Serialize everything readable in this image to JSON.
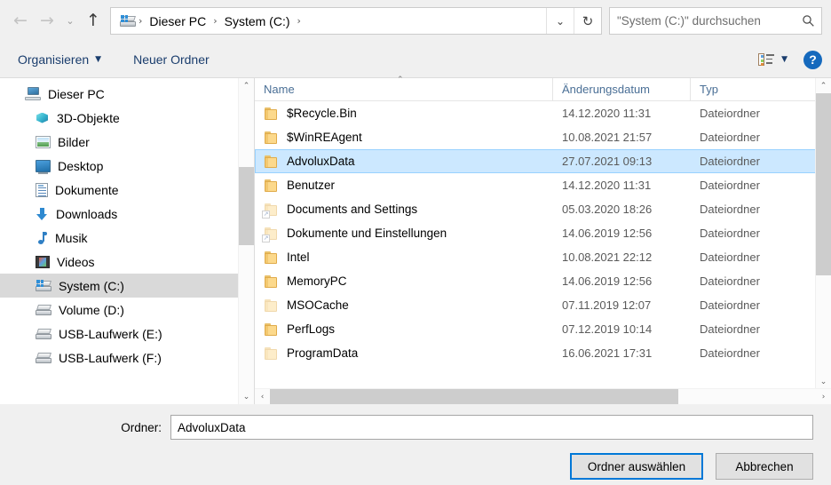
{
  "window": {
    "title": "Ordner auswählen",
    "accent_color": "#0078d7",
    "selection_color": "#cce8ff"
  },
  "nav": {
    "back_icon": "arrow-left-icon",
    "back_glyph": "←",
    "forward_icon": "arrow-right-icon",
    "forward_glyph": "→",
    "recent_icon": "chevron-down-icon",
    "recent_glyph": "⌄",
    "up_icon": "arrow-up-icon",
    "up_glyph": "↑"
  },
  "addressbar": {
    "leading_icon": "drive-windows-icon",
    "crumbs": [
      {
        "label": "Dieser PC"
      },
      {
        "label": "System (C:)"
      }
    ],
    "separator": "›",
    "dropdown_icon": "chevron-down-icon",
    "dropdown_glyph": "⌄",
    "refresh_icon": "refresh-icon",
    "refresh_glyph": "↻"
  },
  "search": {
    "placeholder": "\"System (C:)\" durchsuchen",
    "value": "",
    "icon": "search-icon"
  },
  "toolbar": {
    "organize_label": "Organisieren",
    "organize_caret": "▼",
    "new_folder_label": "Neuer Ordner",
    "view_icon": "list-view-icon",
    "view_caret": "▼",
    "help_icon": "help-icon",
    "help_label": "?"
  },
  "sidebar": {
    "scroll_up_glyph": "⌃",
    "scroll_down_glyph": "⌄",
    "items": [
      {
        "label": "Dieser PC",
        "icon": "computer-icon",
        "level": 0,
        "selected": false
      },
      {
        "label": "3D-Objekte",
        "icon": "3d-objects-icon",
        "level": 1,
        "selected": false
      },
      {
        "label": "Bilder",
        "icon": "pictures-icon",
        "level": 1,
        "selected": false
      },
      {
        "label": "Desktop",
        "icon": "desktop-icon",
        "level": 1,
        "selected": false
      },
      {
        "label": "Dokumente",
        "icon": "documents-icon",
        "level": 1,
        "selected": false
      },
      {
        "label": "Downloads",
        "icon": "downloads-icon",
        "level": 1,
        "selected": false
      },
      {
        "label": "Musik",
        "icon": "music-icon",
        "level": 1,
        "selected": false
      },
      {
        "label": "Videos",
        "icon": "videos-icon",
        "level": 1,
        "selected": false
      },
      {
        "label": "System (C:)",
        "icon": "system-drive-icon",
        "level": 1,
        "selected": true
      },
      {
        "label": "Volume (D:)",
        "icon": "drive-icon",
        "level": 1,
        "selected": false
      },
      {
        "label": "USB-Laufwerk (E:)",
        "icon": "drive-icon",
        "level": 1,
        "selected": false
      },
      {
        "label": "USB-Laufwerk (F:)",
        "icon": "drive-icon",
        "level": 1,
        "selected": false
      }
    ]
  },
  "filelist": {
    "columns": [
      {
        "key": "name",
        "label": "Name",
        "sorted": true,
        "sort_glyph": "⌃"
      },
      {
        "key": "date",
        "label": "Änderungsdatum",
        "sorted": false
      },
      {
        "key": "type",
        "label": "Typ",
        "sorted": false
      }
    ],
    "scroll_up_glyph": "⌃",
    "scroll_down_glyph": "⌄",
    "hscroll_left_glyph": "‹",
    "hscroll_right_glyph": "›",
    "rows": [
      {
        "name": "$Recycle.Bin",
        "date": "14.12.2020 11:31",
        "type": "Dateiordner",
        "icon": "folder-icon",
        "selected": false,
        "dim": false,
        "shortcut": false
      },
      {
        "name": "$WinREAgent",
        "date": "10.08.2021 21:57",
        "type": "Dateiordner",
        "icon": "folder-icon",
        "selected": false,
        "dim": false,
        "shortcut": false
      },
      {
        "name": "AdvoluxData",
        "date": "27.07.2021 09:13",
        "type": "Dateiordner",
        "icon": "folder-icon",
        "selected": true,
        "dim": false,
        "shortcut": false
      },
      {
        "name": "Benutzer",
        "date": "14.12.2020 11:31",
        "type": "Dateiordner",
        "icon": "folder-icon",
        "selected": false,
        "dim": false,
        "shortcut": false
      },
      {
        "name": "Documents and Settings",
        "date": "05.03.2020 18:26",
        "type": "Dateiordner",
        "icon": "folder-shortcut-icon",
        "selected": false,
        "dim": true,
        "shortcut": true
      },
      {
        "name": "Dokumente und Einstellungen",
        "date": "14.06.2019 12:56",
        "type": "Dateiordner",
        "icon": "folder-shortcut-icon",
        "selected": false,
        "dim": true,
        "shortcut": true
      },
      {
        "name": "Intel",
        "date": "10.08.2021 22:12",
        "type": "Dateiordner",
        "icon": "folder-icon",
        "selected": false,
        "dim": false,
        "shortcut": false
      },
      {
        "name": "MemoryPC",
        "date": "14.06.2019 12:56",
        "type": "Dateiordner",
        "icon": "folder-icon",
        "selected": false,
        "dim": false,
        "shortcut": false
      },
      {
        "name": "MSOCache",
        "date": "07.11.2019 12:07",
        "type": "Dateiordner",
        "icon": "folder-icon",
        "selected": false,
        "dim": true,
        "shortcut": false
      },
      {
        "name": "PerfLogs",
        "date": "07.12.2019 10:14",
        "type": "Dateiordner",
        "icon": "folder-icon",
        "selected": false,
        "dim": false,
        "shortcut": false
      },
      {
        "name": "ProgramData",
        "date": "16.06.2021 17:31",
        "type": "Dateiordner",
        "icon": "folder-icon",
        "selected": false,
        "dim": true,
        "shortcut": false
      }
    ]
  },
  "footer": {
    "folder_label": "Ordner:",
    "folder_value": "AdvoluxData",
    "confirm_label": "Ordner auswählen",
    "cancel_label": "Abbrechen"
  }
}
